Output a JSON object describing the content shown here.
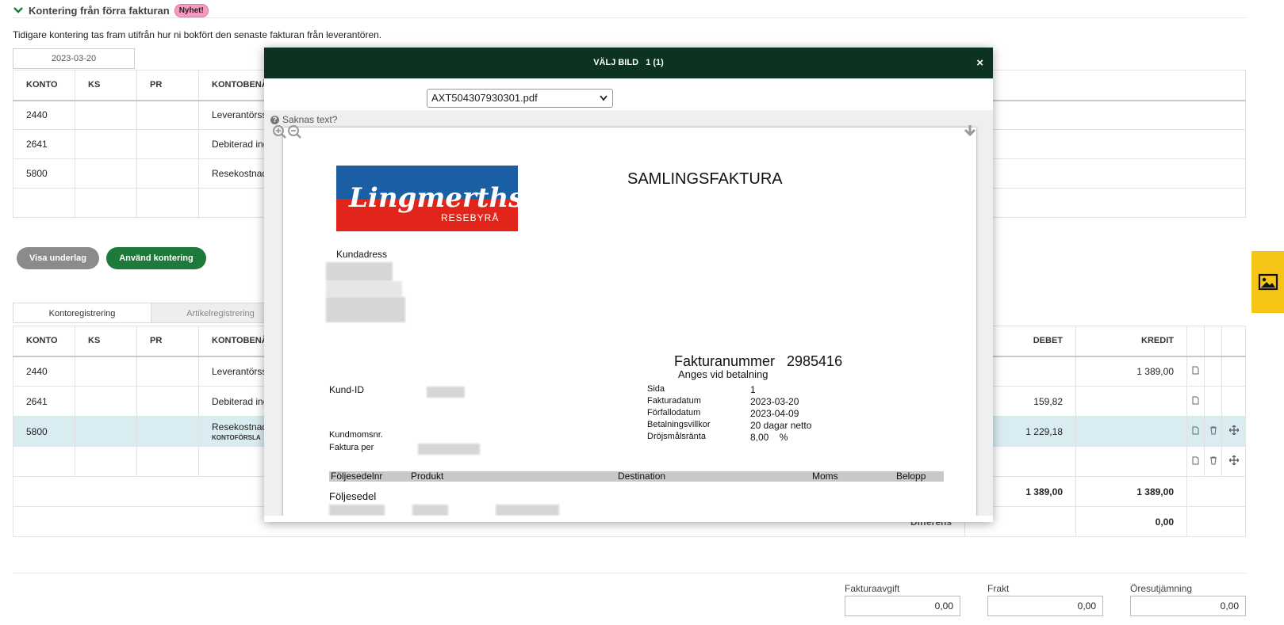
{
  "section": {
    "title": "Kontering från förra fakturan",
    "badge": "Nyhet!",
    "intro": "Tidigare kontering tas fram utifrån hur ni bokfört den senaste fakturan från leverantören.",
    "date": "2023-03-20"
  },
  "prev_table": {
    "headers": [
      "KONTO",
      "KS",
      "PR",
      "KONTOBENÄ"
    ],
    "rows": [
      {
        "konto": "2440",
        "name": "Leverantörss"
      },
      {
        "konto": "2641",
        "name": "Debiterad ing"
      },
      {
        "konto": "5800",
        "name": "Resekostnad"
      }
    ]
  },
  "buttons": {
    "show_basis": "Visa underlag",
    "use_posting": "Använd kontering"
  },
  "tabs": [
    "Kontoregistrering",
    "Artikelregistrering"
  ],
  "main_table": {
    "headers": {
      "konto": "KONTO",
      "ks": "KS",
      "pr": "PR",
      "name": "KONTOBENÄ",
      "debet": "DEBET",
      "kredit": "KREDIT"
    },
    "rows": [
      {
        "konto": "2440",
        "name": "Leverantörss",
        "debet": "",
        "kredit": "1 389,00"
      },
      {
        "konto": "2641",
        "name": "Debiterad ing",
        "debet": "159,82",
        "kredit": ""
      },
      {
        "konto": "5800",
        "name": "Resekostnad",
        "sub": "KONTOFÖRSLA",
        "debet": "1 229,18",
        "kredit": ""
      }
    ],
    "totals": {
      "debet": "1 389,00",
      "kredit": "1 389,00"
    },
    "difference": {
      "label": "Differens",
      "value": "0,00"
    }
  },
  "fees": [
    {
      "label": "Fakturaavgift",
      "value": "0,00"
    },
    {
      "label": "Frakt",
      "value": "0,00"
    },
    {
      "label": "Öresutjämning",
      "value": "0,00"
    }
  ],
  "modal": {
    "title": "VÄLJ BILD   1 (1)",
    "close": "×",
    "file": "AXT504307930301.pdf",
    "missing_text": "Saknas text?"
  },
  "invoice": {
    "logo_text": "Lingmerths",
    "logo_sub": "RESEBYRÅ",
    "title": "SAMLINGSFAKTURA",
    "customer_address_label": "Kundadress",
    "invoice_number_label": "Fakturanummer",
    "invoice_number": "2985416",
    "payment_note": "Anges vid betalning",
    "customer_id_label": "Kund-ID",
    "customer_vat_label": "Kundmomsnr.",
    "invoice_per_label": "Faktura per",
    "details": [
      {
        "label": "Sida",
        "value": "1"
      },
      {
        "label": "Fakturadatum",
        "value": "2023-03-20"
      },
      {
        "label": "Förfallodatum",
        "value": "2023-04-09"
      },
      {
        "label": "Betalningsvillkor",
        "value": "20 dagar netto"
      },
      {
        "label": "Dröjsmålsränta",
        "value": "8,00    %"
      }
    ],
    "line_headers": [
      "Följesedelnr",
      "Produkt",
      "Destination",
      "Moms",
      "Belopp"
    ],
    "delivery_note": "Följesedel"
  },
  "colors": {
    "header_green": "#0c3321",
    "button_green": "#1e7a3a",
    "highlight_row": "#d9ecf2",
    "badge_pink": "#f49ac1",
    "side_tab_yellow": "#f6c417",
    "logo_blue": "#1a5fa3",
    "logo_red": "#e1251b"
  }
}
